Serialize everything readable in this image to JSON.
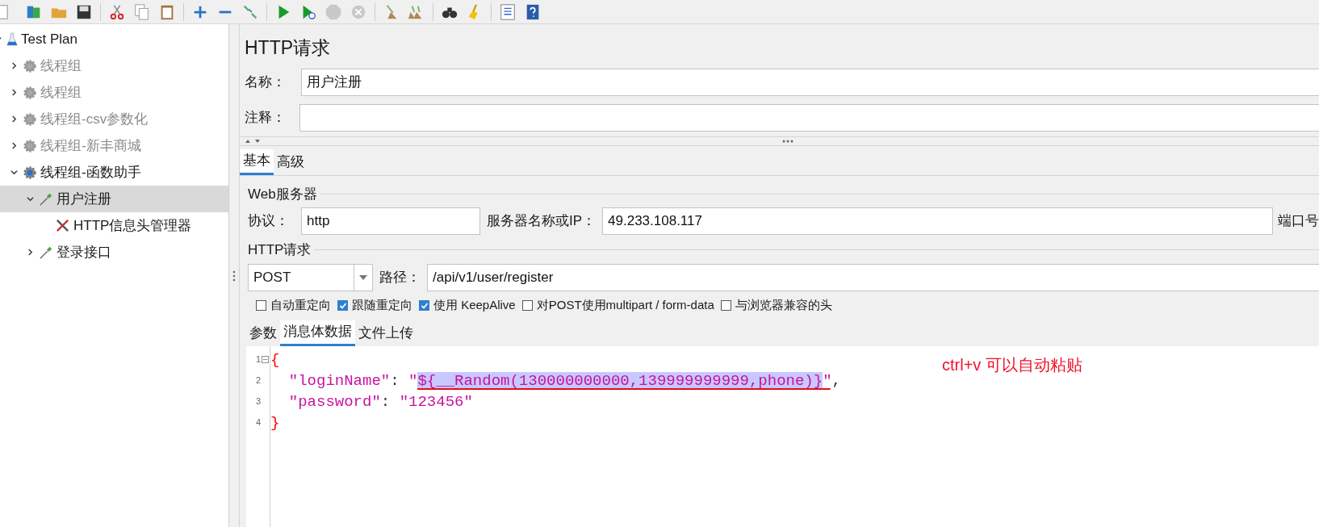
{
  "tree": [
    {
      "label": "Test Plan",
      "kind": "test-plan",
      "expanded": true,
      "selected": false,
      "disabled": false,
      "children": [
        {
          "label": "线程组",
          "kind": "thread-group",
          "expanded": false,
          "selected": false,
          "disabled": true
        },
        {
          "label": "线程组",
          "kind": "thread-group",
          "expanded": false,
          "selected": false,
          "disabled": true
        },
        {
          "label": "线程组-csv参数化",
          "kind": "thread-group",
          "expanded": false,
          "selected": false,
          "disabled": true
        },
        {
          "label": "线程组-新丰商城",
          "kind": "thread-group",
          "expanded": false,
          "selected": false,
          "disabled": true
        },
        {
          "label": "线程组-函数助手",
          "kind": "thread-group",
          "expanded": true,
          "selected": false,
          "disabled": false,
          "children": [
            {
              "label": "用户注册",
              "kind": "sampler",
              "expanded": true,
              "selected": true,
              "disabled": false,
              "children": [
                {
                  "label": "HTTP信息头管理器",
                  "kind": "config",
                  "selected": false,
                  "disabled": false
                }
              ]
            },
            {
              "label": "登录接口",
              "kind": "sampler",
              "expanded": false,
              "selected": false,
              "disabled": false
            }
          ]
        }
      ]
    }
  ],
  "panel": {
    "title": "HTTP请求",
    "name_label": "名称：",
    "name_value": "用户注册",
    "comment_label": "注释："
  },
  "tabs": [
    {
      "label": "基本",
      "selected": true
    },
    {
      "label": "高级",
      "selected": false
    }
  ],
  "web_server": {
    "title": "Web服务器",
    "protocol_label": "协议：",
    "protocol_value": "http",
    "server_label": "服务器名称或IP：",
    "server_value": "49.233.108.117",
    "port_label": "端口号"
  },
  "http_request": {
    "title": "HTTP请求",
    "method": "POST",
    "path_label": "路径：",
    "path_value": "/api/v1/user/register"
  },
  "options": [
    {
      "label": "自动重定向",
      "checked": false
    },
    {
      "label": "跟随重定向",
      "checked": true
    },
    {
      "label": "使用 KeepAlive",
      "checked": true
    },
    {
      "label": "对POST使用multipart / form-data",
      "checked": false
    },
    {
      "label": "与浏览器兼容的头",
      "checked": false
    }
  ],
  "body_tabs": [
    {
      "label": "参数",
      "selected": false
    },
    {
      "label": "消息体数据",
      "selected": true
    },
    {
      "label": "文件上传",
      "selected": false
    }
  ],
  "code_lines": [
    {
      "number": "1",
      "foldable": true,
      "tokens": [
        {
          "text": "{",
          "kind": "brace"
        }
      ]
    },
    {
      "number": "2",
      "foldable": false,
      "tokens": [
        {
          "text": "  \"loginName\"",
          "kind": "string"
        },
        {
          "text": ": ",
          "kind": "punct"
        },
        {
          "text": "\"",
          "kind": "string"
        },
        {
          "text": "${__Random(130000000000,139999999999,phone)}",
          "kind": "selected"
        },
        {
          "text": "\"",
          "kind": "string"
        },
        {
          "text": ",",
          "kind": "punct"
        }
      ]
    },
    {
      "number": "3",
      "foldable": false,
      "tokens": [
        {
          "text": "  \"password\"",
          "kind": "string"
        },
        {
          "text": ": ",
          "kind": "punct"
        },
        {
          "text": "\"123456\"",
          "kind": "string"
        }
      ]
    },
    {
      "number": "4",
      "foldable": false,
      "tokens": [
        {
          "text": "}",
          "kind": "brace"
        }
      ]
    }
  ],
  "annotation": "ctrl+v 可以自动粘贴"
}
